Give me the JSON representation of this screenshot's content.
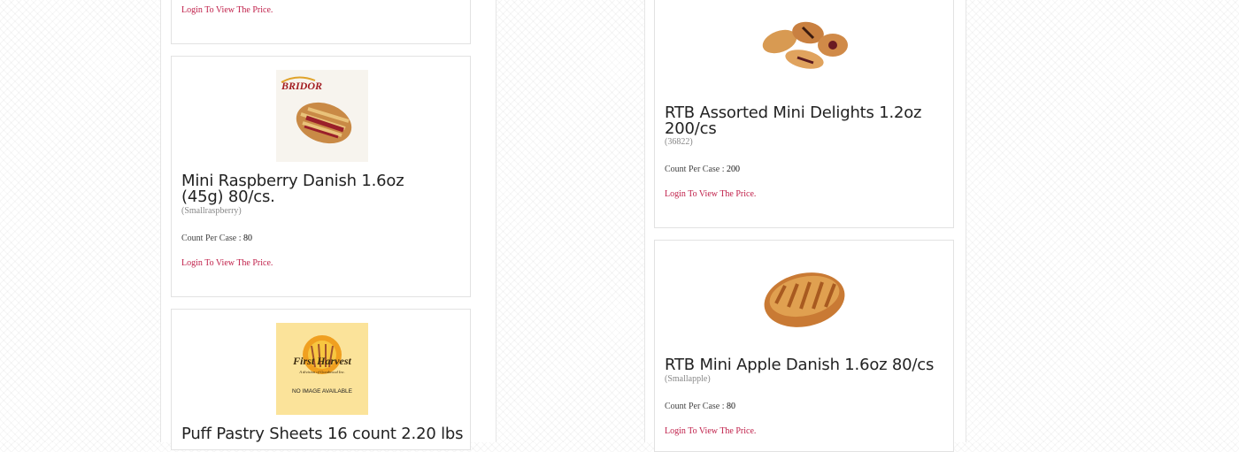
{
  "products": {
    "raspberry_prev": {
      "price_link": "Login To View The Price."
    },
    "raspberry": {
      "title": "Mini Raspberry Danish 1.6oz (45g) 80/cs.",
      "sku": "(Smallraspberry)",
      "count_label": "Count Per Case :",
      "count_value": "80",
      "price_link": "Login To View The Price.",
      "image_brand_text": "BRIDOR"
    },
    "puff": {
      "title": "Puff Pastry Sheets 16 count 2.20 lbs",
      "image_brand_text": "First Harvest",
      "image_tagline": "A division of Goodwood Inc.",
      "image_note": "NO IMAGE AVAILABLE"
    },
    "assorted": {
      "title": "RTB Assorted Mini Delights 1.2oz 200/cs",
      "sku": "(36822)",
      "count_label": "Count Per Case :",
      "count_value": "200",
      "price_link": "Login To View The Price."
    },
    "apple": {
      "title": "RTB Mini Apple Danish 1.6oz 80/cs",
      "sku": "(Smallapple)",
      "count_label": "Count Per Case :",
      "count_value": "80",
      "price_link": "Login To View The Price."
    }
  },
  "colors": {
    "link": "#c0204a",
    "title": "#222222",
    "border": "#e2e2e2"
  }
}
